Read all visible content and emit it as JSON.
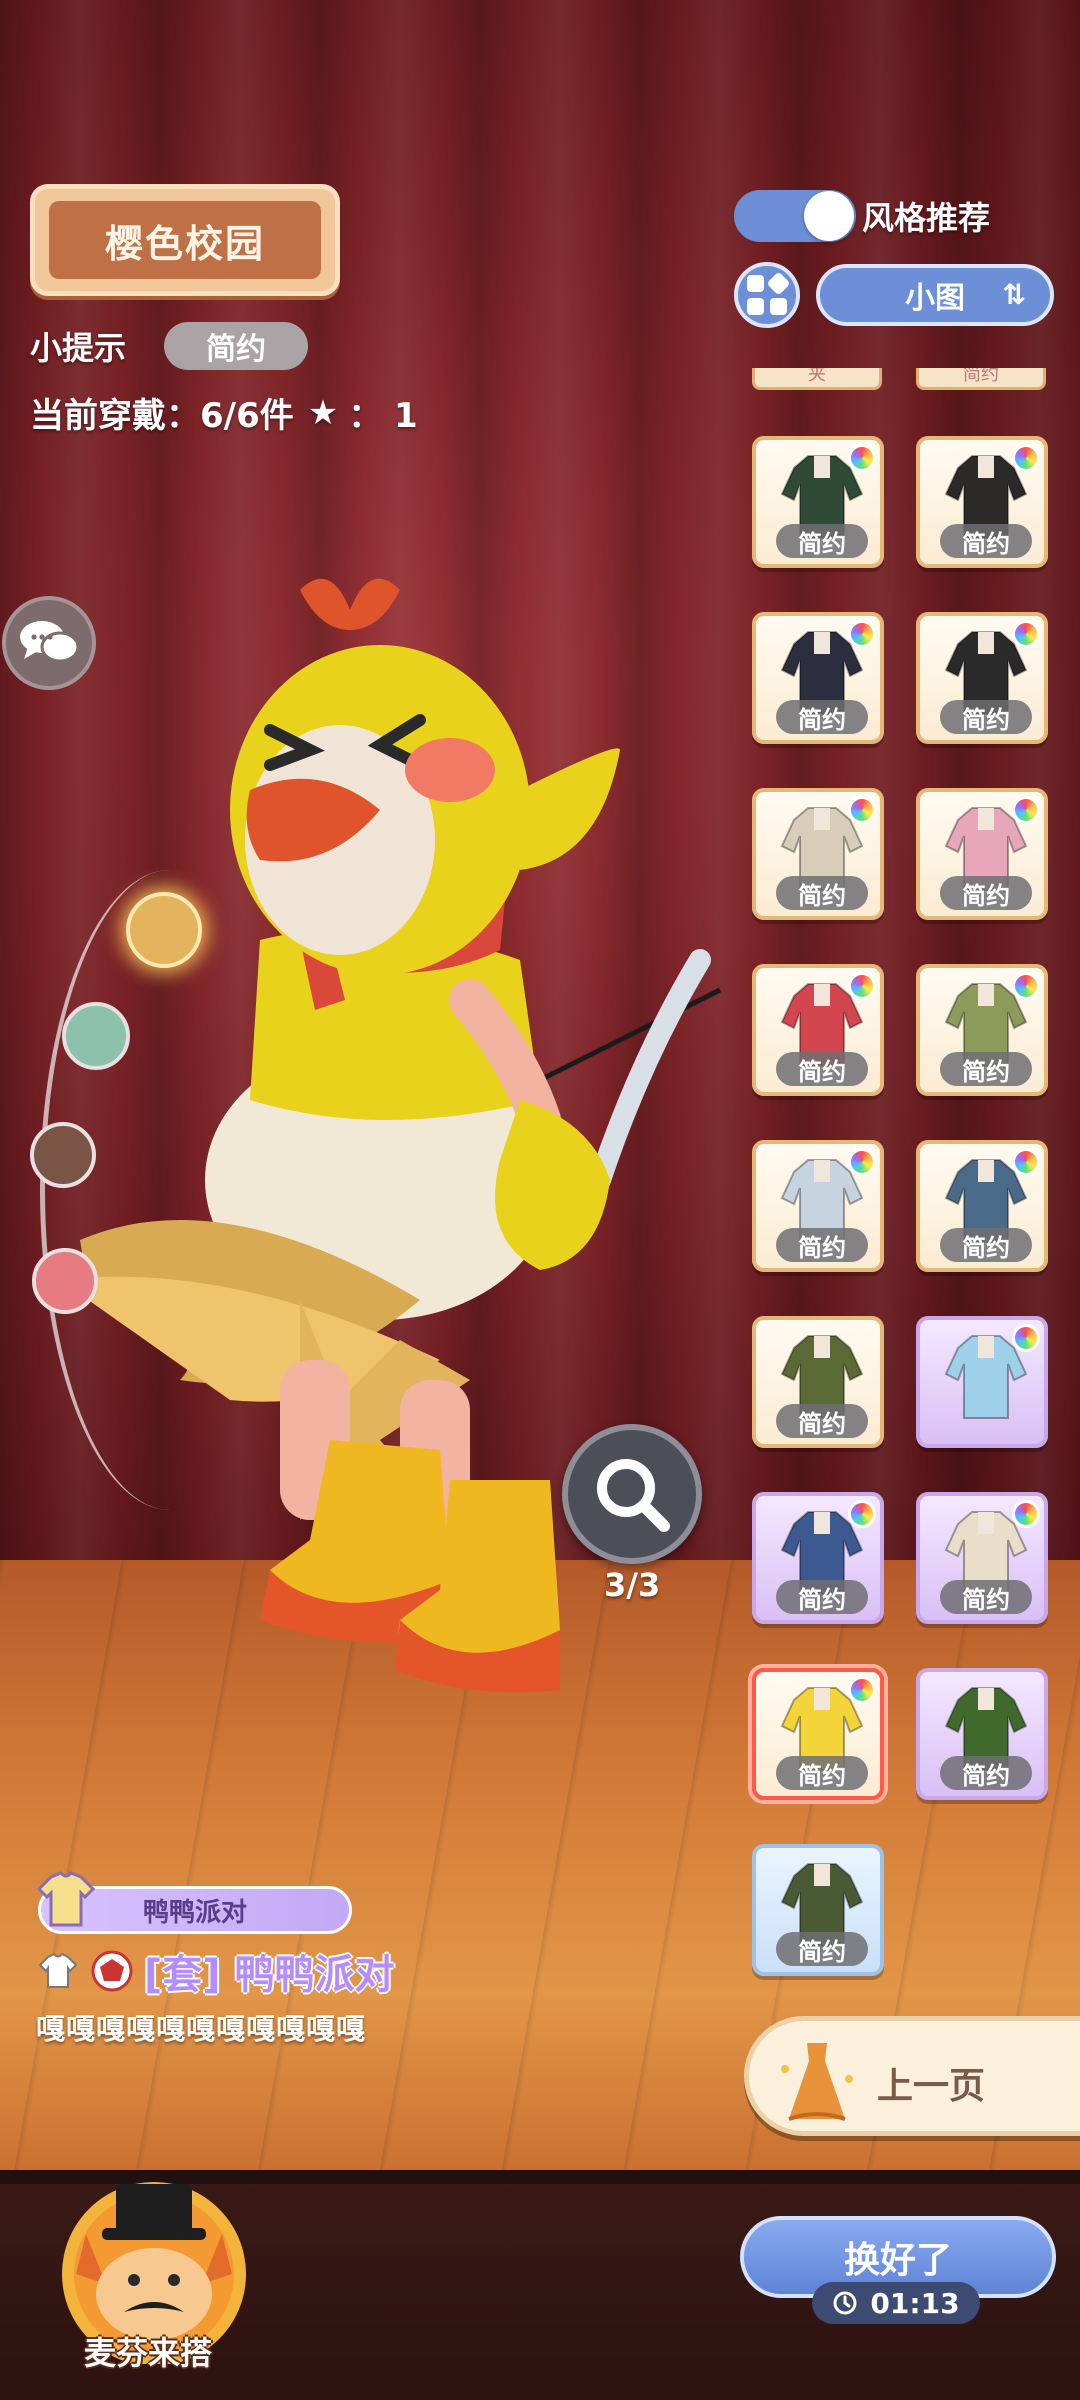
{
  "header": {
    "theme_title": "樱色校园",
    "tip_label": "小提示",
    "tip_value": "简约",
    "wearing_label": "当前穿戴：",
    "wearing_count": "6/6件",
    "star_label": "★",
    "star_value": "：  1"
  },
  "controls": {
    "style_recommend_label": "风格推荐",
    "style_recommend_on": true,
    "size_label": "小图",
    "size_arrows": "⇅"
  },
  "palette": {
    "colors": [
      "#e3b35e",
      "#8cc1ab",
      "#7a5444",
      "#e67b82"
    ],
    "selected_index": 0
  },
  "zoom": {
    "count": "3/3"
  },
  "items": {
    "peek_labels": [
      "夹",
      "简约"
    ],
    "tag": "简约",
    "list": [
      {
        "tag": "简约",
        "style": "cream",
        "colorful": true,
        "outfit": "#2f4b38"
      },
      {
        "tag": "简约",
        "style": "cream",
        "colorful": true,
        "outfit": "#2b2a28"
      },
      {
        "tag": "简约",
        "style": "cream",
        "colorful": true,
        "outfit": "#2a2e3f"
      },
      {
        "tag": "简约",
        "style": "cream",
        "colorful": true,
        "outfit": "#2a2a2a"
      },
      {
        "tag": "简约",
        "style": "cream",
        "colorful": true,
        "outfit": "#d8cdb8"
      },
      {
        "tag": "简约",
        "style": "cream",
        "colorful": true,
        "outfit": "#e8a7b8"
      },
      {
        "tag": "简约",
        "style": "cream",
        "colorful": true,
        "outfit": "#d3464f"
      },
      {
        "tag": "简约",
        "style": "cream",
        "colorful": true,
        "outfit": "#8c9a5a"
      },
      {
        "tag": "简约",
        "style": "cream",
        "colorful": true,
        "outfit": "#c5d4df"
      },
      {
        "tag": "简约",
        "style": "cream",
        "colorful": true,
        "outfit": "#4a6a8a"
      },
      {
        "tag": "简约",
        "style": "cream",
        "colorful": false,
        "outfit": "#5a6a34"
      },
      {
        "tag": "",
        "style": "purple",
        "colorful": true,
        "outfit": "#9fd0ea"
      },
      {
        "tag": "简约",
        "style": "purple",
        "colorful": true,
        "outfit": "#3c5a90"
      },
      {
        "tag": "简约",
        "style": "purple",
        "colorful": true,
        "outfit": "#e9dfc8"
      },
      {
        "tag": "简约",
        "style": "selected",
        "colorful": true,
        "outfit": "#f3d53a"
      },
      {
        "tag": "简约",
        "style": "purple",
        "colorful": false,
        "outfit": "#3f6a2c"
      },
      {
        "tag": "简约",
        "style": "blue",
        "colorful": false,
        "outfit": "#4a5a34"
      }
    ]
  },
  "set": {
    "pill_label": "鸭鸭派对",
    "name": "[套] 鸭鸭派对",
    "description": "嘎嘎嘎嘎嘎嘎嘎嘎嘎嘎嘎"
  },
  "nav": {
    "prev_page": "上一页"
  },
  "footer": {
    "mascot_label": "麦芬来搭",
    "done_label": "换好了",
    "timer": "01:13"
  }
}
